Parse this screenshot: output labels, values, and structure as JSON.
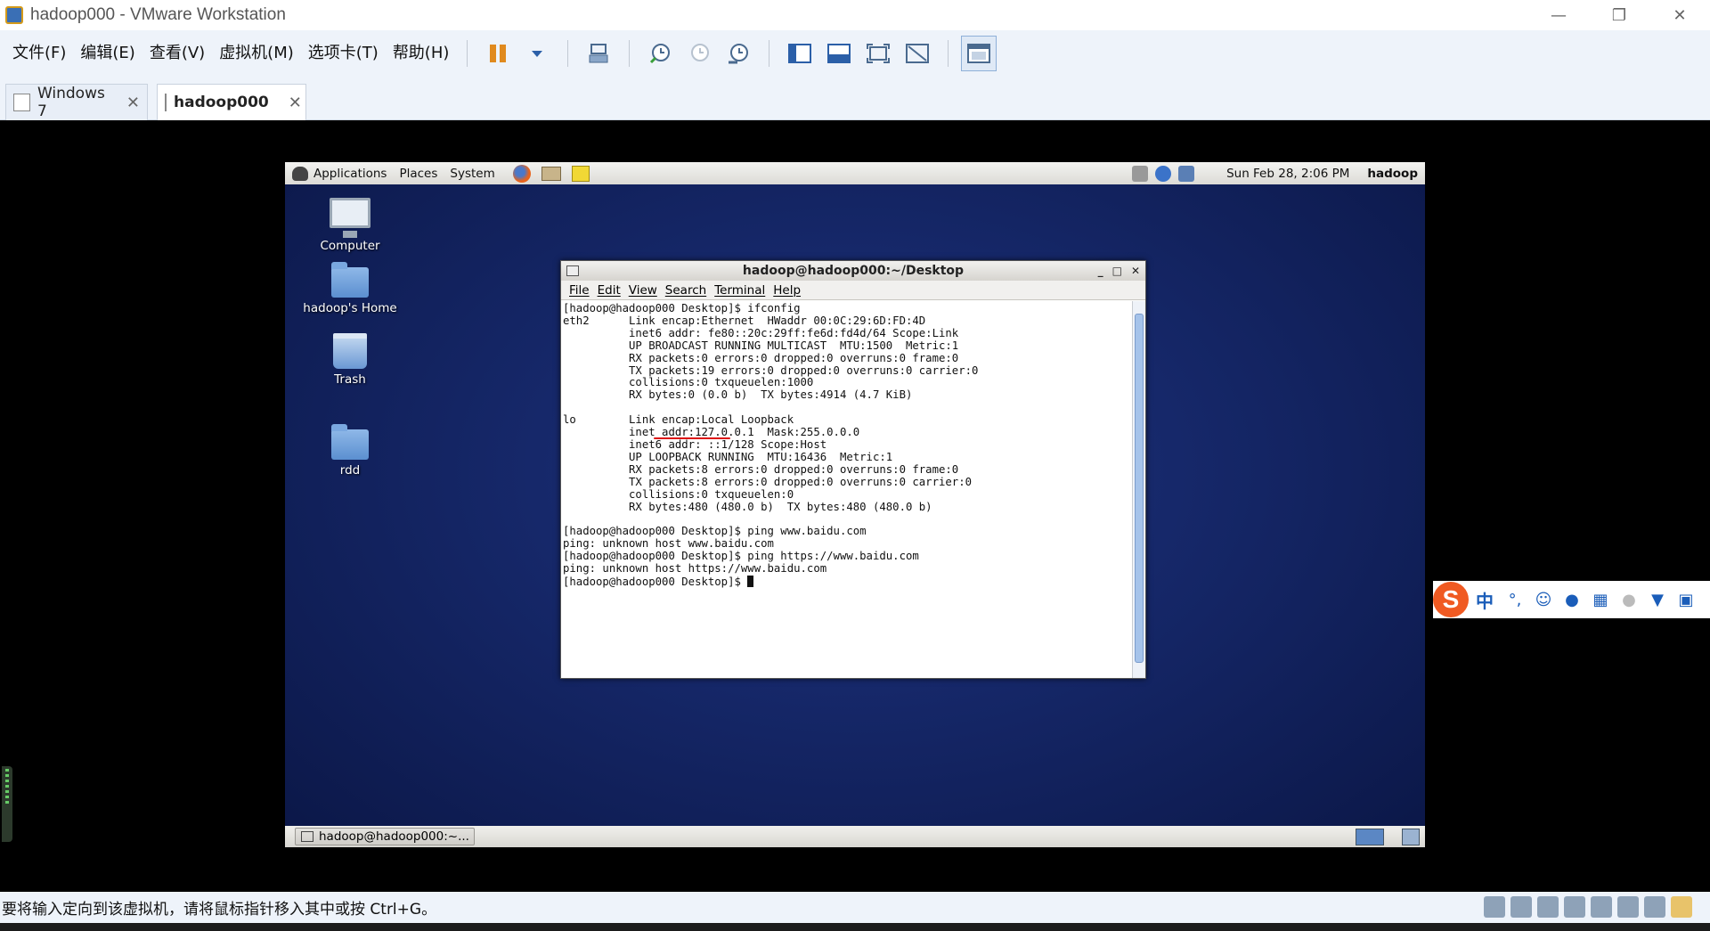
{
  "window": {
    "title": "hadoop000 - VMware Workstation",
    "controls": [
      "—",
      "❐",
      "✕"
    ]
  },
  "menu": [
    "文件(F)",
    "编辑(E)",
    "查看(V)",
    "虚拟机(M)",
    "选项卡(T)",
    "帮助(H)"
  ],
  "tabs": [
    {
      "label": "Windows 7",
      "close": "✕"
    },
    {
      "label": "hadoop000",
      "close": "✕"
    }
  ],
  "guest": {
    "panel": {
      "menus": [
        "Applications",
        "Places",
        "System"
      ],
      "clock": "Sun Feb 28,  2:06 PM",
      "user": "hadoop"
    },
    "desktop_icons": [
      "Computer",
      "hadoop's Home",
      "Trash",
      "rdd"
    ],
    "terminal": {
      "title": "hadoop@hadoop000:~/Desktop",
      "controls": [
        "_",
        "□",
        "✕"
      ],
      "menus": [
        "File",
        "Edit",
        "View",
        "Search",
        "Terminal",
        "Help"
      ],
      "lines": [
        "[hadoop@hadoop000 Desktop]$ ifconfig",
        "eth2      Link encap:Ethernet  HWaddr 00:0C:29:6D:FD:4D  ",
        "          inet6 addr: fe80::20c:29ff:fe6d:fd4d/64 Scope:Link",
        "          UP BROADCAST RUNNING MULTICAST  MTU:1500  Metric:1",
        "          RX packets:0 errors:0 dropped:0 overruns:0 frame:0",
        "          TX packets:19 errors:0 dropped:0 overruns:0 carrier:0",
        "          collisions:0 txqueuelen:1000 ",
        "          RX bytes:0 (0.0 b)  TX bytes:4914 (4.7 KiB)",
        "",
        "lo        Link encap:Local Loopback  ",
        "          inet addr:127.0.0.1  Mask:255.0.0.0",
        "          inet6 addr: ::1/128 Scope:Host",
        "          UP LOOPBACK RUNNING  MTU:16436  Metric:1",
        "          RX packets:8 errors:0 dropped:0 overruns:0 frame:0",
        "          TX packets:8 errors:0 dropped:0 overruns:0 carrier:0",
        "          collisions:0 txqueuelen:0 ",
        "          RX bytes:480 (480.0 b)  TX bytes:480 (480.0 b)",
        "",
        "[hadoop@hadoop000 Desktop]$ ping www.baidu.com",
        "ping: unknown host www.baidu.com",
        "[hadoop@hadoop000 Desktop]$ ping https://www.baidu.com",
        "ping: unknown host https://www.baidu.com",
        "[hadoop@hadoop000 Desktop]$ "
      ]
    },
    "taskbar_item": "hadoop@hadoop000:~..."
  },
  "ime": {
    "logo": "S",
    "mode": "中",
    "punct": "°,"
  },
  "status": {
    "text": "要将输入定向到该虚拟机，请将鼠标指针移入其中或按 Ctrl+G。"
  }
}
